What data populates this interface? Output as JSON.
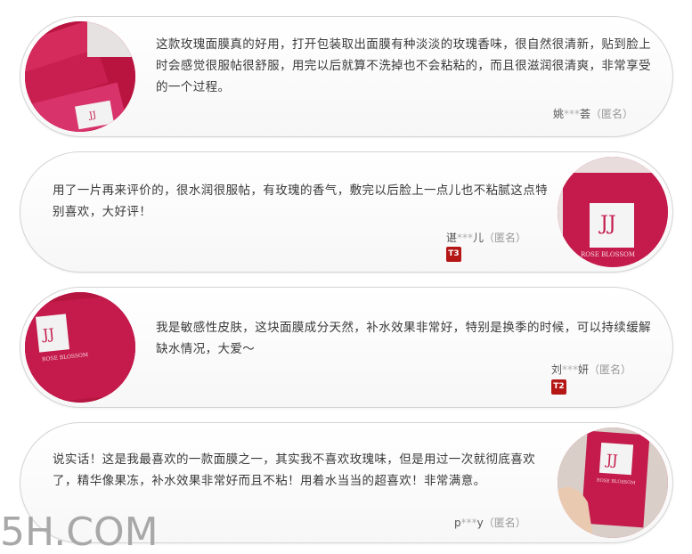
{
  "reviews": [
    {
      "text": "这款玫瑰面膜真的好用，打开包装取出面膜有种淡淡的玫瑰香味，很自然很清新，贴到脸上时会感觉很服帖很舒服，用完以后就算不洗掉也不会粘粘的，而且很滋润很清爽，非常享受的一个过程。",
      "user_prefix": "姚",
      "user_mask": "***",
      "user_suffix": "荟",
      "anon": "（匿名）",
      "avatar_icon": "rose-mask-box-photo",
      "level": ""
    },
    {
      "text": "用了一片再来评价的，很水润很服帖，有玫瑰的香气，敷完以后脸上一点儿也不粘腻这点特别喜欢，大好评！",
      "user_prefix": "谌",
      "user_mask": "***",
      "user_suffix": "儿",
      "anon": "（匿名）",
      "avatar_icon": "rose-blossom-box-photo",
      "avatar_label": "ROSE BLOSSOM",
      "level": "T3"
    },
    {
      "text": "我是敏感性皮肤，这块面膜成分天然，补水效果非常好，特别是换季的时候，可以持续缓解缺水情况，大爱～",
      "user_prefix": "刘",
      "user_mask": "***",
      "user_suffix": "妍",
      "anon": "（匿名）",
      "avatar_icon": "rose-blossom-box-photo",
      "avatar_label": "ROSE BLOSSOM",
      "level": "T2"
    },
    {
      "text": "说实话！这是我最喜欢的一款面膜之一，其实我不喜欢玫瑰味，但是用过一次就彻底喜欢了，精华像果冻，补水效果非常好而且不粘！用着水当当的超喜欢！非常满意。",
      "user_prefix": "p",
      "user_mask": "***",
      "user_suffix": "y",
      "anon": "（匿名）",
      "avatar_icon": "rose-blossom-box-photo",
      "avatar_label": "ROSE BLOSSOM",
      "level": ""
    }
  ],
  "watermark": "5H.COM",
  "colors": {
    "brand_pink": "#c41a4c",
    "badge_red": "#b51717",
    "card_border": "#d4d4d4"
  }
}
